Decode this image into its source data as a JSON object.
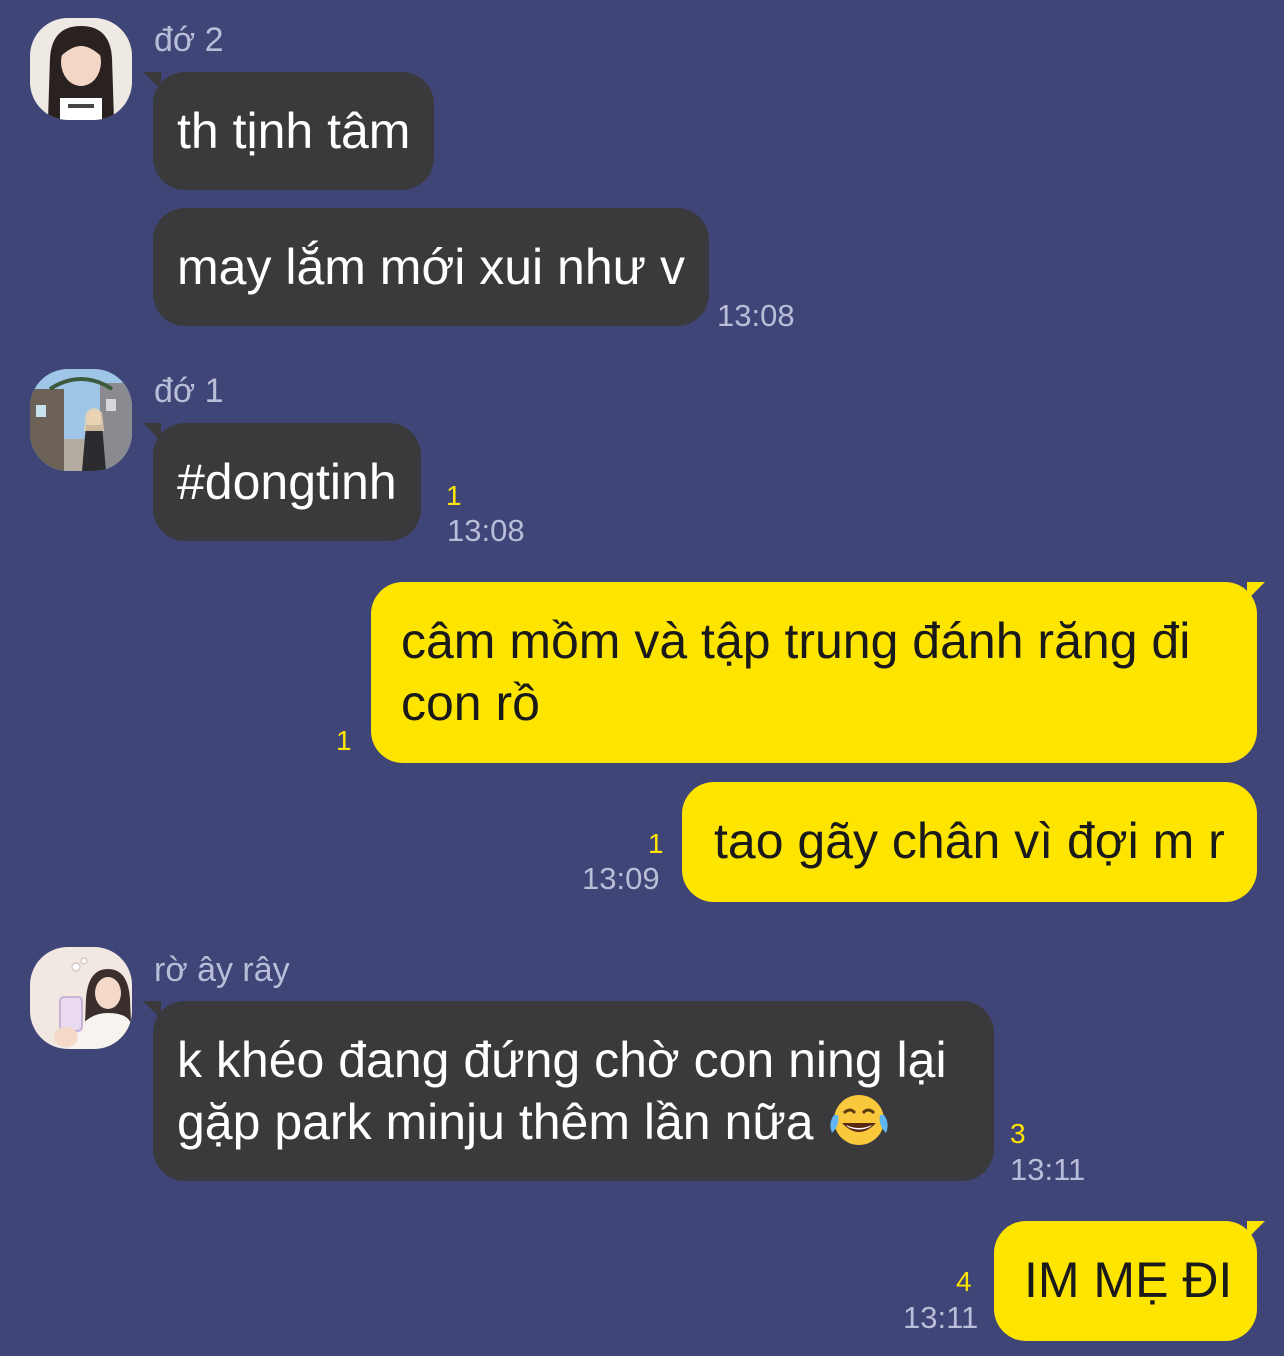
{
  "groups": [
    {
      "sender": "đớ 2",
      "avatar_icon": "profile-photo-girl-dark-hair",
      "messages": [
        {
          "text": "th tịnh tâm"
        },
        {
          "text": "may lắm mới xui như v",
          "time": "13:08"
        }
      ]
    },
    {
      "sender": "đớ 1",
      "avatar_icon": "profile-photo-street-scene",
      "messages": [
        {
          "text": "#dongtinh",
          "unread": "1",
          "time": "13:08"
        }
      ]
    },
    {
      "sender": "rờ ây rây",
      "avatar_icon": "profile-photo-mirror-selfie",
      "messages": [
        {
          "text_line1": "k khéo đang đứng chờ con ning lại",
          "text_line2": "gặp park minju thêm lần nữa",
          "emoji": "face-with-tears-of-joy-emoji",
          "unread": "3",
          "time": "13:11"
        }
      ]
    }
  ],
  "outgoing": [
    {
      "text_line1": "câm mồm và tập trung đánh răng đi",
      "text_line2": "con rồ",
      "unread": "1"
    },
    {
      "text": "tao gãy chân vì đợi m r",
      "unread": "1",
      "time": "13:09"
    },
    {
      "text": "IM MẸ ĐI",
      "unread": "4",
      "time": "13:11"
    }
  ],
  "colors": {
    "background": "#404577",
    "incoming_bubble": "#3a3a3c",
    "outgoing_bubble": "#fee500",
    "unread_count": "#fee500",
    "meta_text": "#b9bdd8"
  }
}
